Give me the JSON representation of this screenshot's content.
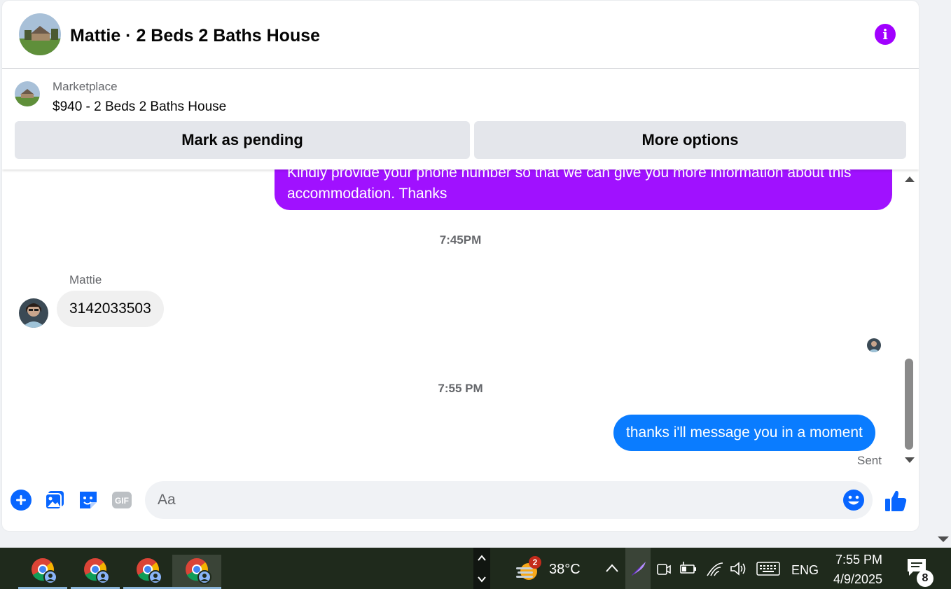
{
  "header": {
    "title": "Mattie · 2 Beds 2 Baths House",
    "info_icon": "i"
  },
  "listing": {
    "source": "Marketplace",
    "price_title": "$940 - 2 Beds 2 Baths House",
    "pending_button": "Mark as pending",
    "options_button": "More options"
  },
  "thread": {
    "outgoing_1": "Kindly provide your phone number so that we can give you more information about this accommodation. Thanks",
    "time_1": "7:45PM",
    "sender_name": "Mattie",
    "incoming_1": "3142033503",
    "time_2": "7:55 PM",
    "outgoing_2": "thanks i'll message you in a moment",
    "status": "Sent"
  },
  "composer": {
    "placeholder": "Aa"
  },
  "taskbar": {
    "weather_badge": "2",
    "temperature": "38°C",
    "language": "ENG",
    "time": "7:55 PM",
    "date": "4/9/2025",
    "notification_count": "8"
  },
  "colors": {
    "accent_purple": "#a011ff",
    "accent_blue": "#0a7cff",
    "messenger_blue": "#0866ff"
  }
}
